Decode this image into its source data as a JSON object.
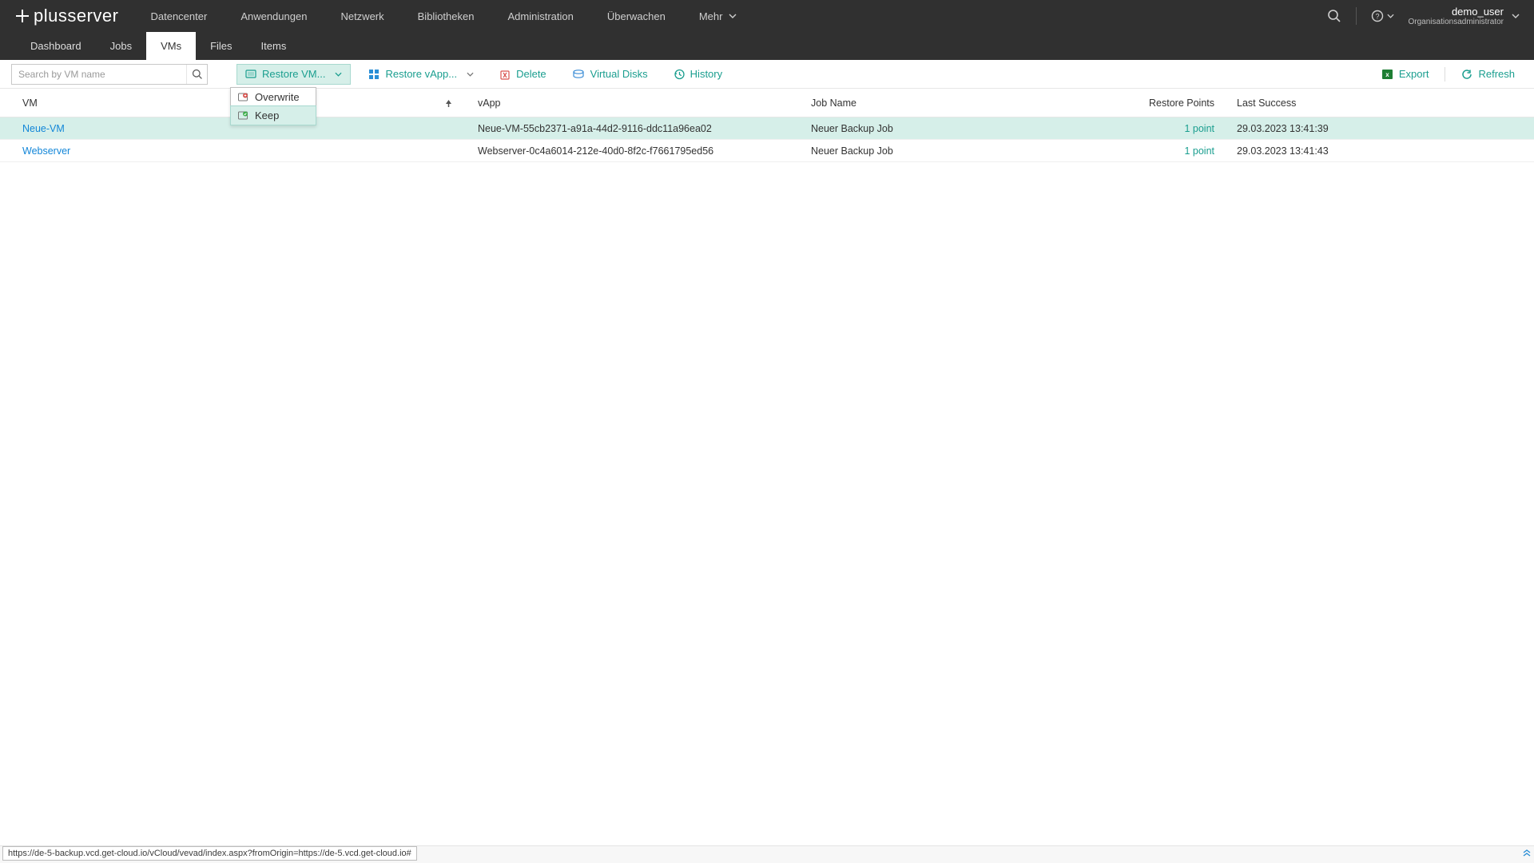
{
  "brand": {
    "part1": "plus",
    "part2": "server"
  },
  "topnav": {
    "datacenter": "Datencenter",
    "applications": "Anwendungen",
    "network": "Netzwerk",
    "libraries": "Bibliotheken",
    "administration": "Administration",
    "monitor": "Überwachen",
    "more": "Mehr"
  },
  "user": {
    "name": "demo_user",
    "role": "Organisationsadministrator"
  },
  "tabs": {
    "dashboard": "Dashboard",
    "jobs": "Jobs",
    "vms": "VMs",
    "files": "Files",
    "items": "Items"
  },
  "search": {
    "placeholder": "Search by VM name"
  },
  "toolbar": {
    "restore_vm": "Restore VM...",
    "restore_vapp": "Restore vApp...",
    "delete": "Delete",
    "virtual_disks": "Virtual Disks",
    "history": "History",
    "export": "Export",
    "refresh": "Refresh"
  },
  "dropdown": {
    "overwrite": "Overwrite",
    "keep": "Keep"
  },
  "columns": {
    "vm": "VM",
    "vapp": "vApp",
    "job": "Job Name",
    "restore_points": "Restore Points",
    "last_success": "Last Success"
  },
  "rows": [
    {
      "vm": "Neue-VM",
      "vapp": "Neue-VM-55cb2371-a91a-44d2-9116-ddc11a96ea02",
      "job": "Neuer Backup Job",
      "rp": "1 point",
      "last": "29.03.2023 13:41:39"
    },
    {
      "vm": "Webserver",
      "vapp": "Webserver-0c4a6014-212e-40d0-8f2c-f7661795ed56",
      "job": "Neuer Backup Job",
      "rp": "1 point",
      "last": "29.03.2023 13:41:43"
    }
  ],
  "status_url": "https://de-5-backup.vcd.get-cloud.io/vCloud/vevad/index.aspx?fromOrigin=https://de-5.vcd.get-cloud.io#"
}
